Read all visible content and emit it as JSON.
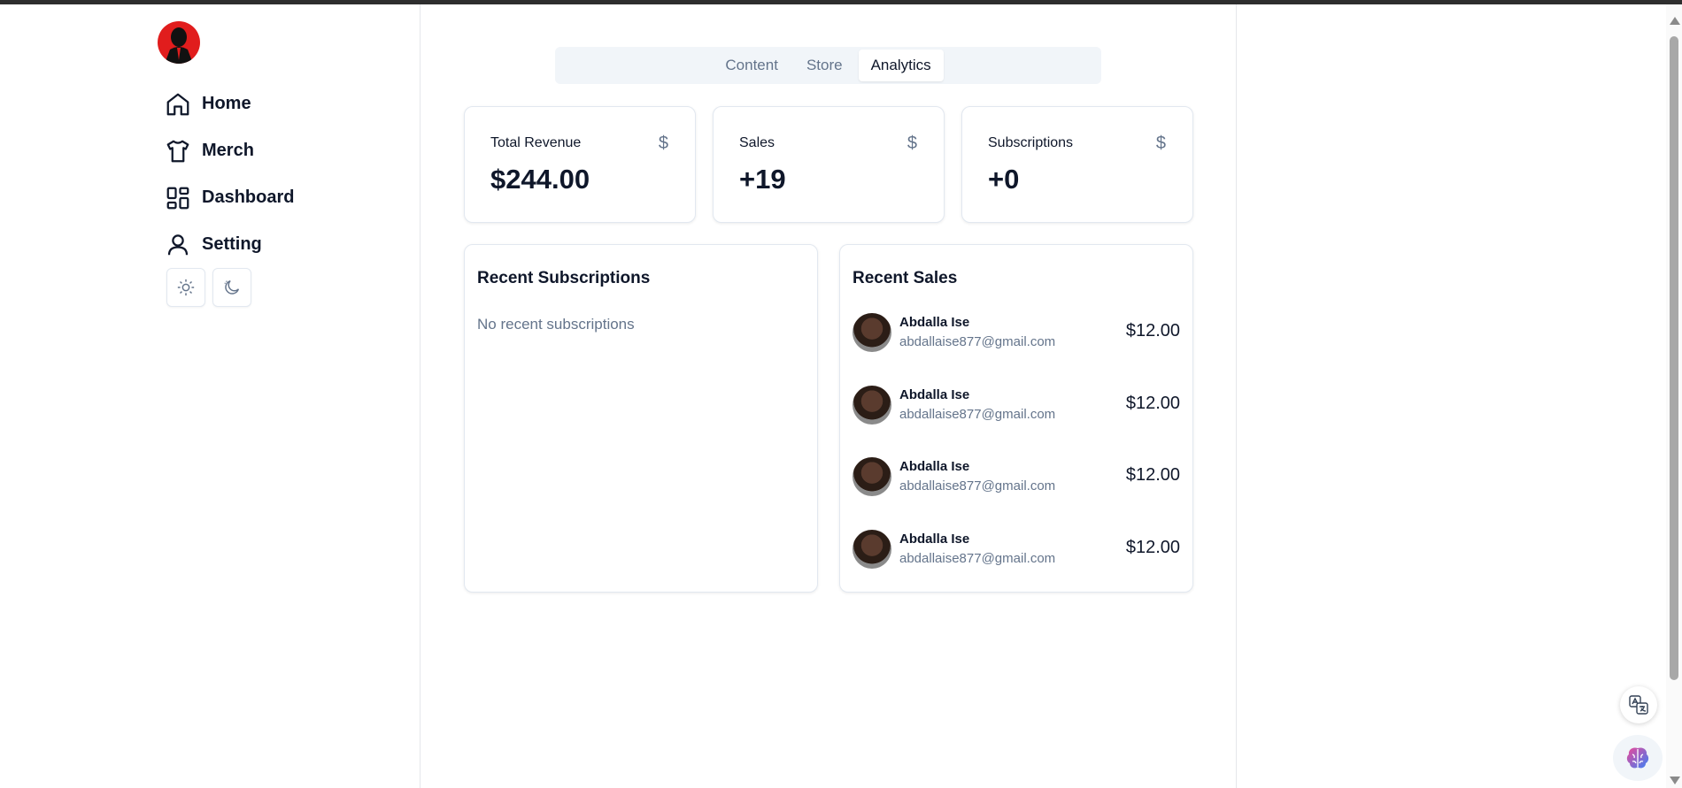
{
  "sidebar": {
    "items": [
      {
        "label": "Home",
        "icon": "home-icon"
      },
      {
        "label": "Merch",
        "icon": "shirt-icon"
      },
      {
        "label": "Dashboard",
        "icon": "dashboard-icon"
      },
      {
        "label": "Setting",
        "icon": "user-icon"
      }
    ],
    "theme_buttons": [
      "sun-icon",
      "moon-icon"
    ]
  },
  "tabs": [
    {
      "label": "Content",
      "active": false
    },
    {
      "label": "Store",
      "active": false
    },
    {
      "label": "Analytics",
      "active": true
    }
  ],
  "stats": [
    {
      "label": "Total Revenue",
      "icon": "$",
      "value": "$244.00"
    },
    {
      "label": "Sales",
      "icon": "$",
      "value": "+19"
    },
    {
      "label": "Subscriptions",
      "icon": "$",
      "value": "+0"
    }
  ],
  "recent_subscriptions": {
    "title": "Recent Subscriptions",
    "empty_text": "No recent subscriptions"
  },
  "recent_sales": {
    "title": "Recent Sales",
    "items": [
      {
        "name": "Abdalla Ise",
        "email": "abdallaise877@gmail.com",
        "amount": "$12.00"
      },
      {
        "name": "Abdalla Ise",
        "email": "abdallaise877@gmail.com",
        "amount": "$12.00"
      },
      {
        "name": "Abdalla Ise",
        "email": "abdallaise877@gmail.com",
        "amount": "$12.00"
      },
      {
        "name": "Abdalla Ise",
        "email": "abdallaise877@gmail.com",
        "amount": "$12.00"
      }
    ]
  },
  "colors": {
    "brand_logo": "#e11d1d",
    "muted_text": "#64748b",
    "tab_bg": "#f1f5f9"
  }
}
